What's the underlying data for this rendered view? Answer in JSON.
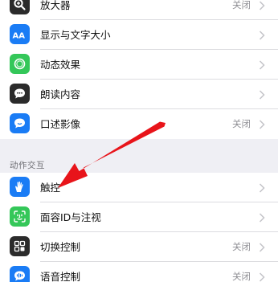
{
  "colors": {
    "background": "#efeff4",
    "separator": "#dcdce0",
    "value_text": "#8e8e93",
    "annotation_arrow": "#e8141a"
  },
  "vision_items": [
    {
      "label": "放大器",
      "value": "关闭",
      "icon": "magnifier-icon",
      "icon_color": "#2b2b2b"
    },
    {
      "label": "显示与文字大小",
      "value": "",
      "icon": "text-size-icon",
      "icon_color": "#1a7cf5"
    },
    {
      "label": "动态效果",
      "value": "",
      "icon": "motion-icon",
      "icon_color": "#34c759"
    },
    {
      "label": "朗读内容",
      "value": "",
      "icon": "speech-bubble-icon",
      "icon_color": "#2b2b2b"
    },
    {
      "label": "口述影像",
      "value": "关闭",
      "icon": "audio-description-icon",
      "icon_color": "#1a7cf5"
    }
  ],
  "section_header": "动作交互",
  "interaction_items": [
    {
      "label": "触控",
      "value": "",
      "icon": "touch-hand-icon",
      "icon_color": "#1a7cf5"
    },
    {
      "label": "面容ID与注视",
      "value": "",
      "icon": "face-id-icon",
      "icon_color": "#34c759"
    },
    {
      "label": "切换控制",
      "value": "关闭",
      "icon": "switch-control-icon",
      "icon_color": "#2b2b2b"
    },
    {
      "label": "语音控制",
      "value": "关闭",
      "icon": "voice-control-icon",
      "icon_color": "#1a7cf5"
    }
  ]
}
